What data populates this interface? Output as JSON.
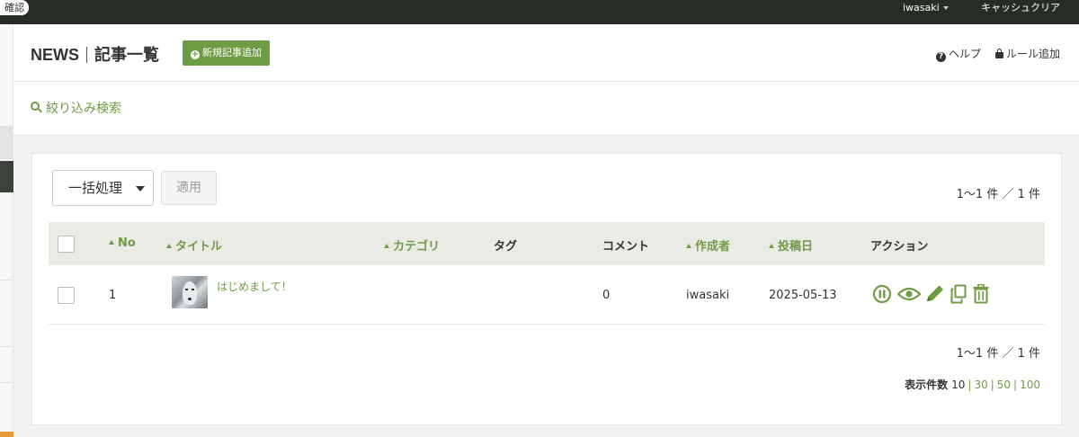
{
  "topbar": {
    "confirm_badge": "確認",
    "user": "iwasaki",
    "cache_clear": "キャッシュクリア"
  },
  "header": {
    "section": "NEWS",
    "title": "記事一覧",
    "add_button": "新規記事追加",
    "add_icon": "plus-circle-icon",
    "help_link": "ヘルプ",
    "help_icon": "question-circle-icon",
    "rule_link": "ルール追加",
    "rule_icon": "lock-icon"
  },
  "filter": {
    "label": "絞り込み検索",
    "icon": "search-icon"
  },
  "toolbar": {
    "bulk_action": "一括処理",
    "apply_button": "適用",
    "count_top": "1〜1 件 ／ 1 件",
    "count_bottom": "1〜1 件 ／ 1 件"
  },
  "table": {
    "columns": {
      "no": "No",
      "title": "タイトル",
      "category": "カテゴリ",
      "tag": "タグ",
      "comment": "コメント",
      "author": "作成者",
      "posted": "投稿日",
      "action": "アクション"
    },
    "rows": [
      {
        "no": "1",
        "title": "はじめまして！",
        "category": "",
        "tag": "",
        "comment": "0",
        "author": "iwasaki",
        "posted": "2025-05-13",
        "actions": [
          "pause-circle-icon",
          "eye-icon",
          "pencil-icon",
          "copy-icon",
          "trash-icon"
        ]
      }
    ]
  },
  "pagination": {
    "label": "表示件数",
    "current": "10",
    "options": [
      "30",
      "50",
      "100"
    ]
  },
  "colors": {
    "accent": "#6e9c45",
    "topbar": "#272c26",
    "table_header": "#ebebe6"
  }
}
